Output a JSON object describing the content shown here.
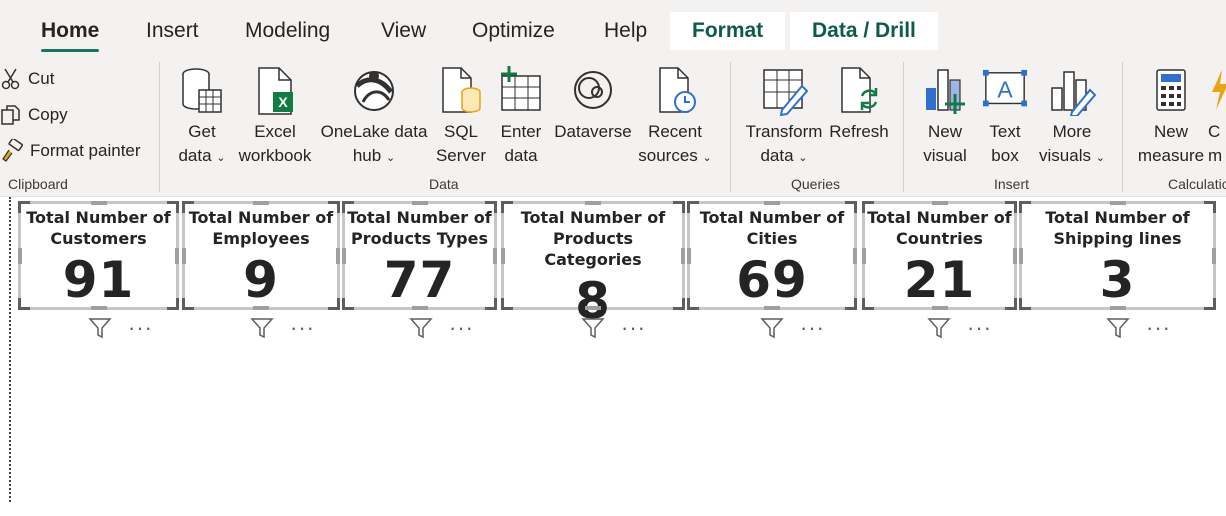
{
  "tabs": [
    "Home",
    "Insert",
    "Modeling",
    "View",
    "Optimize",
    "Help"
  ],
  "context_tabs": [
    "Format",
    "Data / Drill"
  ],
  "clipboard": {
    "cut": "Cut",
    "copy": "Copy",
    "format_painter": "Format painter",
    "group": "Clipboard"
  },
  "data_group": {
    "get_data": [
      "Get",
      "data"
    ],
    "excel": [
      "Excel",
      "workbook"
    ],
    "onelake": [
      "OneLake data",
      "hub"
    ],
    "sql": [
      "SQL",
      "Server"
    ],
    "enter": [
      "Enter",
      "data"
    ],
    "dataverse": "Dataverse",
    "recent": [
      "Recent",
      "sources"
    ],
    "group": "Data"
  },
  "queries_group": {
    "transform": [
      "Transform",
      "data"
    ],
    "refresh": "Refresh",
    "group": "Queries"
  },
  "insert_group": {
    "new_visual": [
      "New",
      "visual"
    ],
    "text_box": [
      "Text",
      "box"
    ],
    "more_visuals": [
      "More",
      "visuals"
    ],
    "group": "Insert"
  },
  "calc_group": {
    "new_measure": [
      "New",
      "measure"
    ],
    "partial_label": "m",
    "partial_top": "C",
    "group": "Calculatio"
  },
  "cards": [
    {
      "title": [
        "Total Number of",
        "Customers"
      ],
      "value": "91"
    },
    {
      "title": [
        "Total Number of",
        "Employees"
      ],
      "value": "9"
    },
    {
      "title": [
        "Total Number of",
        "Products Types"
      ],
      "value": "77"
    },
    {
      "title": [
        "Total Number of",
        "Products Categories"
      ],
      "value": "8"
    },
    {
      "title": [
        "Total Number of",
        "Cities"
      ],
      "value": "69"
    },
    {
      "title": [
        "Total Number of",
        "Countries"
      ],
      "value": "21"
    },
    {
      "title": [
        "Total Number of",
        "Shipping lines"
      ],
      "value": "3"
    }
  ],
  "more_options": "···",
  "colors": {
    "accent": "#117865",
    "context_tab_text": "#0e5a4b",
    "excel_green": "#107c41",
    "power_bi_yellow": "#e8a317",
    "visual_blue": "#2f6fcf"
  }
}
